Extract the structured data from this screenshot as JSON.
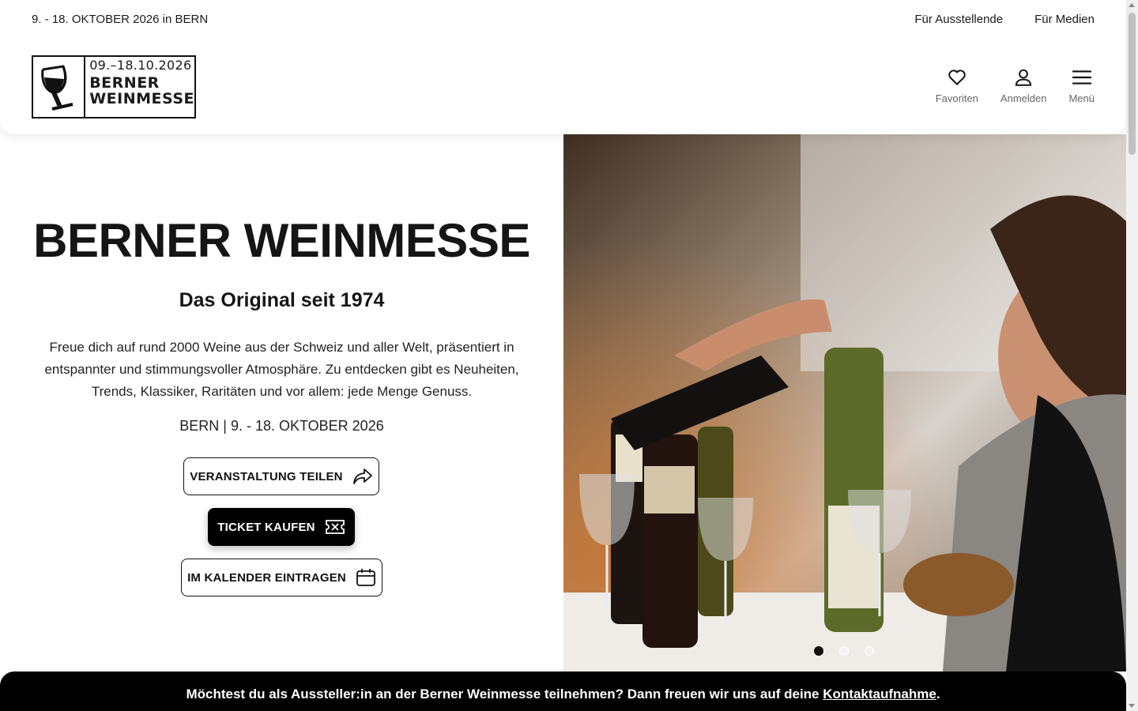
{
  "topbar": {
    "date_text": "9. - 18. OKTOBER 2026 in BERN",
    "links": [
      "Für Ausstellende",
      "Für Medien"
    ]
  },
  "logo": {
    "dates": "09.–18.10.2026",
    "line1": "BERNER",
    "line2": "WEINMESSE"
  },
  "nav": {
    "favorites": "Favoriten",
    "login": "Anmelden",
    "menu": "Menü"
  },
  "hero": {
    "title": "BERNER WEINMESSE",
    "subtitle": "Das Original seit 1974",
    "description": "Freue dich auf rund 2000 Weine aus der Schweiz und aller Welt, präsentiert in entspannter und stimmungsvoller Atmosphäre. Zu entdecken gibt es Neuheiten, Trends, Klassiker, Raritäten und vor allem: jede Menge Genuss.",
    "when": "BERN | 9. - 18. OKTOBER 2026",
    "buttons": {
      "share": "VERANSTALTUNG TEILEN",
      "ticket": "TICKET KAUFEN",
      "calendar": "IM KALENDER EINTRAGEN"
    },
    "image_alt": "wine-pouring-photo",
    "slides_total": 3,
    "slide_active": 1
  },
  "banner": {
    "text": "Möchtest du als Aussteller:in an der Berner Weinmesse teilnehmen? Dann freuen wir uns auf deine ",
    "link": "Kontaktaufnahme",
    "suffix": "."
  },
  "colors": {
    "primary": "#000000",
    "background": "#ffffff",
    "muted": "#666666"
  }
}
